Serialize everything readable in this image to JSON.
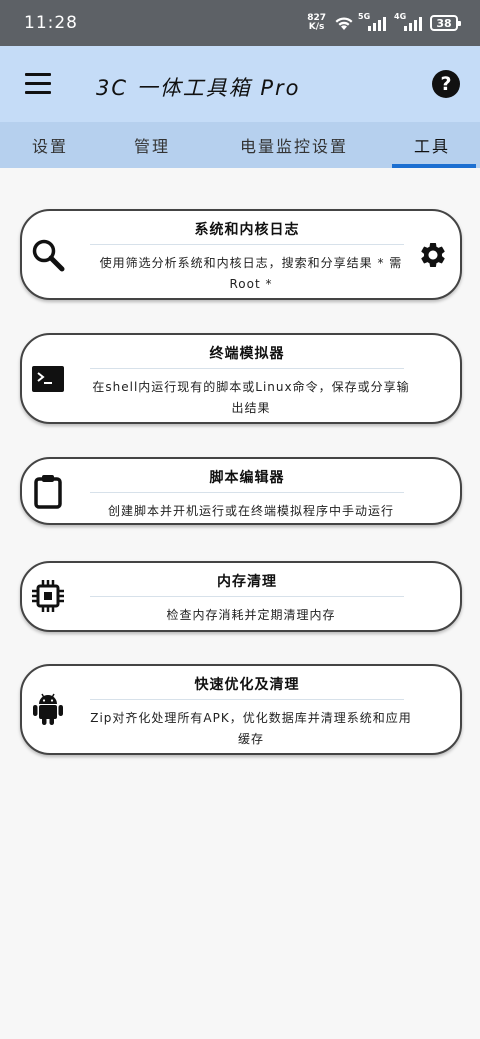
{
  "status_bar": {
    "time": "11:28",
    "net_speed_value": "827",
    "net_speed_unit": "K/s",
    "signal1_tag": "5G",
    "signal2_tag": "4G",
    "battery": "38"
  },
  "app_bar": {
    "title": "3C 一体工具箱 Pro",
    "menu_icon": "menu-icon",
    "help_icon": "help-icon",
    "help_glyph": "?"
  },
  "tabs": [
    {
      "label": "设置",
      "active": false
    },
    {
      "label": "管理",
      "active": false
    },
    {
      "label": "电量监控设置",
      "active": false
    },
    {
      "label": "工具",
      "active": true
    }
  ],
  "tools": [
    {
      "title": "系统和内核日志",
      "description": "使用筛选分析系统和内核日志，搜索和分享结果 * 需Root *",
      "icon": "search-icon",
      "has_settings": true
    },
    {
      "title": "终端模拟器",
      "description": "在shell内运行现有的脚本或Linux命令，保存或分享输出结果",
      "icon": "terminal-icon",
      "has_settings": false
    },
    {
      "title": "脚本编辑器",
      "description": "创建脚本并开机运行或在终端模拟程序中手动运行",
      "icon": "clipboard-icon",
      "has_settings": false
    },
    {
      "title": "内存清理",
      "description": "检查内存消耗并定期清理内存",
      "icon": "memory-chip-icon",
      "has_settings": false
    },
    {
      "title": "快速优化及清理",
      "description": "Zip对齐化处理所有APK，优化数据库并清理系统和应用缓存",
      "icon": "android-icon",
      "has_settings": false
    }
  ],
  "colors": {
    "status_bar": "#5d6166",
    "app_bar": "#c5dcf7",
    "tab_bar": "#b6d0ee",
    "tab_indicator": "#1c6fd1",
    "background": "#f7f7f7"
  }
}
